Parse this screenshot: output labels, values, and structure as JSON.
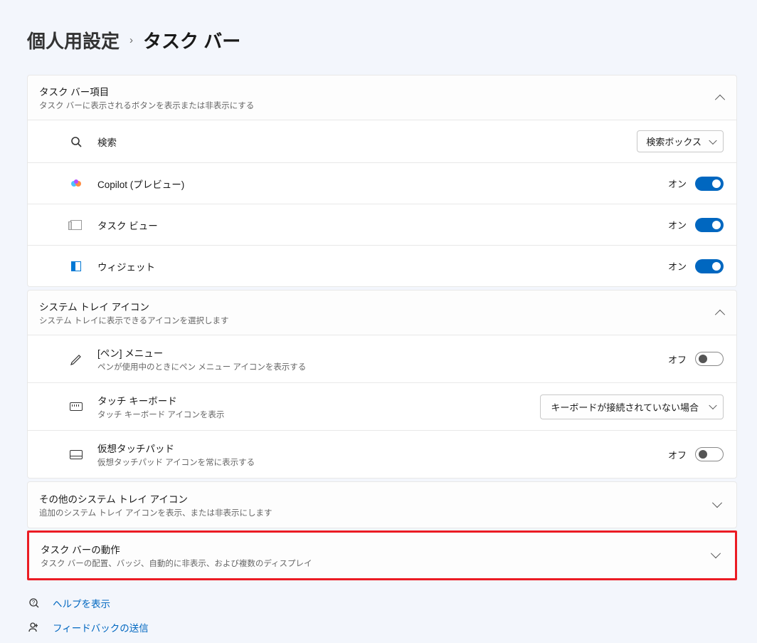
{
  "breadcrumb": {
    "root": "個人用設定",
    "current": "タスク バー"
  },
  "sections": {
    "items": {
      "title": "タスク バー項目",
      "desc": "タスク バーに表示されるボタンを表示または非表示にする",
      "search": {
        "label": "検索",
        "select": "検索ボックス"
      },
      "copilot": {
        "label": "Copilot (プレビュー)",
        "state": "オン"
      },
      "taskview": {
        "label": "タスク ビュー",
        "state": "オン"
      },
      "widgets": {
        "label": "ウィジェット",
        "state": "オン"
      }
    },
    "tray": {
      "title": "システム トレイ アイコン",
      "desc": "システム トレイに表示できるアイコンを選択します",
      "pen": {
        "label": "[ペン] メニュー",
        "desc": "ペンが使用中のときにペン メニュー アイコンを表示する",
        "state": "オフ"
      },
      "touchkb": {
        "label": "タッチ キーボード",
        "desc": "タッチ キーボード アイコンを表示",
        "select": "キーボードが接続されていない場合"
      },
      "touchpad": {
        "label": "仮想タッチパッド",
        "desc": "仮想タッチパッド アイコンを常に表示する",
        "state": "オフ"
      }
    },
    "other_tray": {
      "title": "その他のシステム トレイ アイコン",
      "desc": "追加のシステム トレイ アイコンを表示、または非表示にします"
    },
    "behavior": {
      "title": "タスク バーの動作",
      "desc": "タスク バーの配置、バッジ、自動的に非表示、および複数のディスプレイ"
    }
  },
  "footer": {
    "help": "ヘルプを表示",
    "feedback": "フィードバックの送信"
  }
}
